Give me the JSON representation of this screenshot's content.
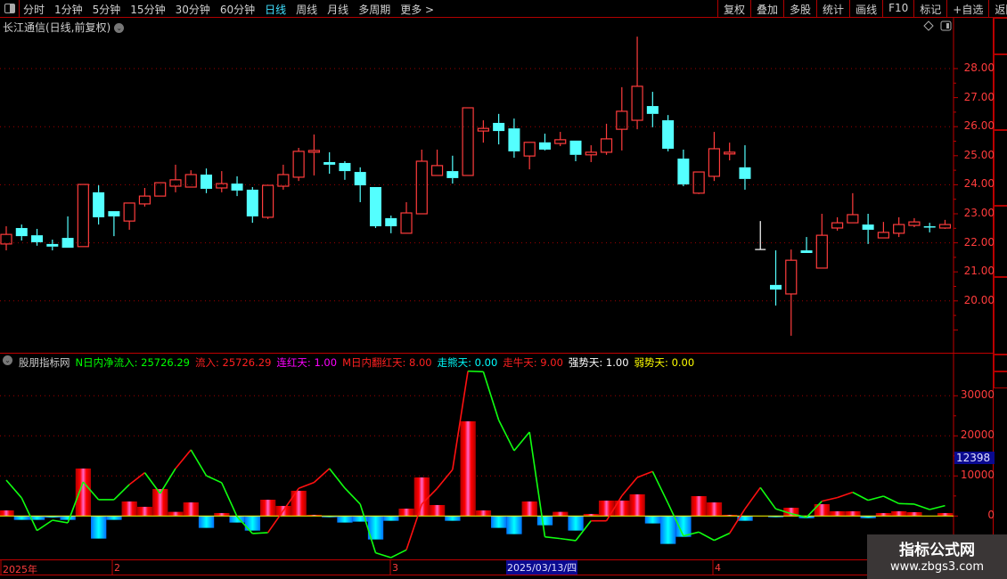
{
  "toolbar": {
    "periods": [
      "分时",
      "1分钟",
      "5分钟",
      "15分钟",
      "30分钟",
      "60分钟",
      "日线",
      "周线",
      "月线",
      "多周期",
      "更多 >"
    ],
    "active_period": "日线",
    "right_buttons": [
      "复权",
      "叠加",
      "多股",
      "统计",
      "画线",
      "F10",
      "标记",
      "+自选",
      "返回"
    ]
  },
  "chart_title": "长江通信(日线,前复权)",
  "indicator": {
    "name": "股朋指标网",
    "items": [
      {
        "label": "N日内净流入: 25726.29",
        "color": "#00ff00"
      },
      {
        "label": "流入: 25726.29",
        "color": "#ff2020"
      },
      {
        "label": "连红天: 1.00",
        "color": "#ff00ff"
      },
      {
        "label": "M日内翻红天: 8.00",
        "color": "#ff2020"
      },
      {
        "label": "走熊天: 0.00",
        "color": "#00ffff"
      },
      {
        "label": "走牛天: 9.00",
        "color": "#ff2020"
      },
      {
        "label": "强势天: 1.00",
        "color": "#ffffff"
      },
      {
        "label": "弱势天: 0.00",
        "color": "#ffff00"
      }
    ],
    "cursor_value": "12398"
  },
  "price_axis": [
    "28.00",
    "27.00",
    "26.00",
    "25.00",
    "24.00",
    "23.00",
    "22.00",
    "21.00",
    "20.00"
  ],
  "indicator_axis": [
    "30000",
    "20000",
    "10000",
    "0"
  ],
  "x_axis": {
    "labels": [
      "2025年",
      "2",
      "3",
      "4"
    ],
    "selected": "2025/03/13/四"
  },
  "watermark": {
    "line1": "指标公式网",
    "line2": "www.zbgs3.com"
  },
  "colors": {
    "up": "#ff3c3c",
    "down": "#54ffff",
    "grid": "#a00000",
    "zero": "#ffff00",
    "line_up": "#ff1010",
    "line_down": "#10ff10"
  },
  "chart_data": {
    "type": "candlestick+bar+line",
    "price_range": [
      18.8,
      29.1
    ],
    "indicator_range": [
      -11000,
      37000
    ],
    "candles_ohlc": [
      [
        21.96,
        22.57,
        21.74,
        22.29
      ],
      [
        22.51,
        22.63,
        22.08,
        22.23
      ],
      [
        22.26,
        22.48,
        21.9,
        22.02
      ],
      [
        21.96,
        22.11,
        21.74,
        21.87
      ],
      [
        22.17,
        22.91,
        21.83,
        21.83
      ],
      [
        21.87,
        24.01,
        21.87,
        24.01
      ],
      [
        23.74,
        23.98,
        22.63,
        22.88
      ],
      [
        23.09,
        23.09,
        22.23,
        22.91
      ],
      [
        22.75,
        23.37,
        22.45,
        23.37
      ],
      [
        23.34,
        23.89,
        23.25,
        23.61
      ],
      [
        23.61,
        24.07,
        23.61,
        24.07
      ],
      [
        23.95,
        24.69,
        23.74,
        24.17
      ],
      [
        23.92,
        24.5,
        23.92,
        24.35
      ],
      [
        24.35,
        24.56,
        23.71,
        23.86
      ],
      [
        23.89,
        24.47,
        23.74,
        24.04
      ],
      [
        24.04,
        24.29,
        23.61,
        23.8
      ],
      [
        23.83,
        23.92,
        22.69,
        22.91
      ],
      [
        22.88,
        23.98,
        22.82,
        23.98
      ],
      [
        23.95,
        24.69,
        23.83,
        24.35
      ],
      [
        24.26,
        25.27,
        24.13,
        25.15
      ],
      [
        25.12,
        25.73,
        24.32,
        25.18
      ],
      [
        24.78,
        25.12,
        24.38,
        24.69
      ],
      [
        24.75,
        24.81,
        24.17,
        24.47
      ],
      [
        24.44,
        24.6,
        23.4,
        23.98
      ],
      [
        23.92,
        23.92,
        22.51,
        22.57
      ],
      [
        22.85,
        22.94,
        22.33,
        22.57
      ],
      [
        22.33,
        23.4,
        22.33,
        23.03
      ],
      [
        23.0,
        25.21,
        23.0,
        24.81
      ],
      [
        24.32,
        25.21,
        24.32,
        24.66
      ],
      [
        24.47,
        25.0,
        24.04,
        24.23
      ],
      [
        24.32,
        26.65,
        24.32,
        26.65
      ],
      [
        25.85,
        26.22,
        25.45,
        25.94
      ],
      [
        26.13,
        26.44,
        25.39,
        25.85
      ],
      [
        25.94,
        26.28,
        24.93,
        25.15
      ],
      [
        24.99,
        25.46,
        24.53,
        25.46
      ],
      [
        25.46,
        25.76,
        25.18,
        25.21
      ],
      [
        25.42,
        25.82,
        25.33,
        25.55
      ],
      [
        25.52,
        25.52,
        24.81,
        25.03
      ],
      [
        25.03,
        25.36,
        24.78,
        25.12
      ],
      [
        25.12,
        26.1,
        25.03,
        25.58
      ],
      [
        25.91,
        27.36,
        25.18,
        26.53
      ],
      [
        26.22,
        29.1,
        25.91,
        27.39
      ],
      [
        26.71,
        27.2,
        25.98,
        26.44
      ],
      [
        26.22,
        26.4,
        25.15,
        25.24
      ],
      [
        24.9,
        25.21,
        23.95,
        24.01
      ],
      [
        23.71,
        24.44,
        23.68,
        24.44
      ],
      [
        24.29,
        25.82,
        24.13,
        25.24
      ],
      [
        25.06,
        25.45,
        24.84,
        25.12
      ],
      [
        24.6,
        25.36,
        23.83,
        24.2
      ],
      [
        21.77,
        22.75,
        21.77,
        21.77
      ],
      [
        20.55,
        21.74,
        19.84,
        20.39
      ],
      [
        20.24,
        21.77,
        18.8,
        21.4
      ],
      [
        21.74,
        22.2,
        21.65,
        21.65
      ],
      [
        21.13,
        23.0,
        21.13,
        22.26
      ],
      [
        22.51,
        22.88,
        22.42,
        22.69
      ],
      [
        22.69,
        23.71,
        22.69,
        22.97
      ],
      [
        22.63,
        23.0,
        21.96,
        22.45
      ],
      [
        22.17,
        22.72,
        22.17,
        22.36
      ],
      [
        22.33,
        22.88,
        22.2,
        22.63
      ],
      [
        22.6,
        22.85,
        22.54,
        22.72
      ],
      [
        22.57,
        22.69,
        22.36,
        22.54
      ],
      [
        22.51,
        22.79,
        22.48,
        22.63
      ]
    ],
    "indicator_bars": [
      1400,
      -960,
      -960,
      -370,
      -960,
      11850,
      -5630,
      -960,
      3630,
      2300,
      6740,
      1040,
      3400,
      -2960,
      740,
      -1630,
      -3630,
      4070,
      2520,
      6300,
      300,
      -300,
      -1630,
      -1400,
      -5850,
      -1190,
      1850,
      9630,
      2740,
      -1190,
      23630,
      1400,
      -2960,
      -4520,
      3630,
      -2300,
      1040,
      -3630,
      520,
      3850,
      3850,
      5410,
      -1850,
      -6960,
      -5190,
      4960,
      3400,
      300,
      -1190,
      0,
      -300,
      2070,
      -520,
      2960,
      1190,
      1190,
      -520,
      740,
      1190,
      960,
      0,
      740
    ],
    "indicator_line": [
      8960,
      4520,
      -3630,
      -1040,
      -1700,
      8520,
      4070,
      4070,
      7850,
      10810,
      5630,
      11850,
      16520,
      10070,
      8300,
      -150,
      -4370,
      -4150,
      1330,
      6890,
      8370,
      11850,
      6960,
      2960,
      -9190,
      -10370,
      -8440,
      2960,
      6890,
      11560,
      36150,
      36000,
      23930,
      16300,
      20960,
      -5190,
      -5630,
      -6150,
      -1190,
      -1190,
      5040,
      9630,
      11110,
      3190,
      -4960,
      -4000,
      -6070,
      -4300,
      1780,
      7110,
      1780,
      590,
      -300,
      3700,
      4590,
      5930,
      3930,
      4960,
      3110,
      2960,
      1630,
      2590
    ],
    "indicator_line_segment_colors": "ggggggggrggrgggggrrrrgggggrrrrggggggggrrrrgggggrrggggrrgggggg",
    "price_gridlines": [
      28,
      26,
      24,
      22,
      20
    ],
    "indicator_gridlines": [
      10000,
      20000,
      30000
    ]
  }
}
